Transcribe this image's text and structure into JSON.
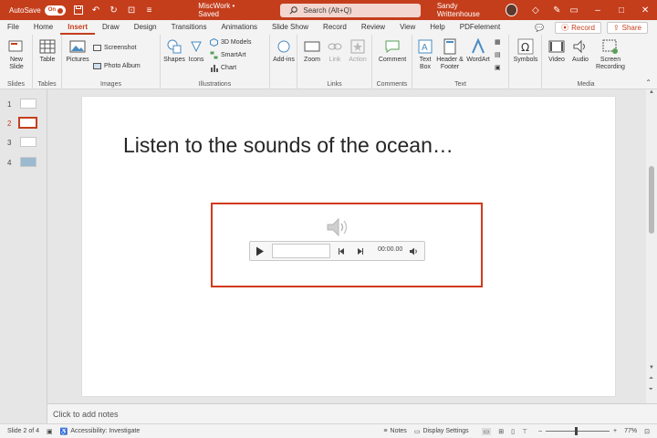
{
  "titlebar": {
    "autosave_label": "AutoSave",
    "autosave_state": "On",
    "document_title": "MiscWork • Saved",
    "search_placeholder": "Search (Alt+Q)",
    "user_name": "Sandy Writtenhouse"
  },
  "tabs": [
    "File",
    "Home",
    "Insert",
    "Draw",
    "Design",
    "Transitions",
    "Animations",
    "Slide Show",
    "Record",
    "Review",
    "View",
    "Help",
    "PDFelement"
  ],
  "active_tab": "Insert",
  "tab_actions": {
    "record": "Record",
    "share": "Share"
  },
  "ribbon": {
    "slides": {
      "label": "Slides",
      "new_slide": "New Slide"
    },
    "tables": {
      "label": "Tables",
      "table": "Table"
    },
    "images": {
      "label": "Images",
      "pictures": "Pictures",
      "screenshot": "Screenshot",
      "photo_album": "Photo Album"
    },
    "illustrations": {
      "label": "Illustrations",
      "shapes": "Shapes",
      "icons": "Icons",
      "models": "3D Models",
      "smartart": "SmartArt",
      "chart": "Chart"
    },
    "addins": {
      "label": "Add-ins",
      "text": "Add-ins"
    },
    "links": {
      "label": "Links",
      "zoom": "Zoom",
      "link": "Link",
      "action": "Action"
    },
    "comments": {
      "label": "Comments",
      "comment": "Comment"
    },
    "text": {
      "label": "Text",
      "textbox": "Text Box",
      "header_footer": "Header & Footer",
      "wordart": "WordArt"
    },
    "symbols": {
      "label": "",
      "symbols": "Symbols"
    },
    "media": {
      "label": "Media",
      "video": "Video",
      "audio": "Audio",
      "screen_recording": "Screen Recording"
    }
  },
  "thumbnails": [
    {
      "num": "1",
      "active": false
    },
    {
      "num": "2",
      "active": true
    },
    {
      "num": "3",
      "active": false
    },
    {
      "num": "4",
      "active": false
    }
  ],
  "slide": {
    "title": "Listen to the sounds of the ocean…",
    "player_time": "00:00.00"
  },
  "notes_placeholder": "Click to add notes",
  "status": {
    "slide_info": "Slide 2 of 4",
    "accessibility": "Accessibility: Investigate",
    "notes": "Notes",
    "display_settings": "Display Settings",
    "zoom": "77%"
  },
  "colors": {
    "accent": "#c43e1c",
    "selection": "#d2391d"
  }
}
